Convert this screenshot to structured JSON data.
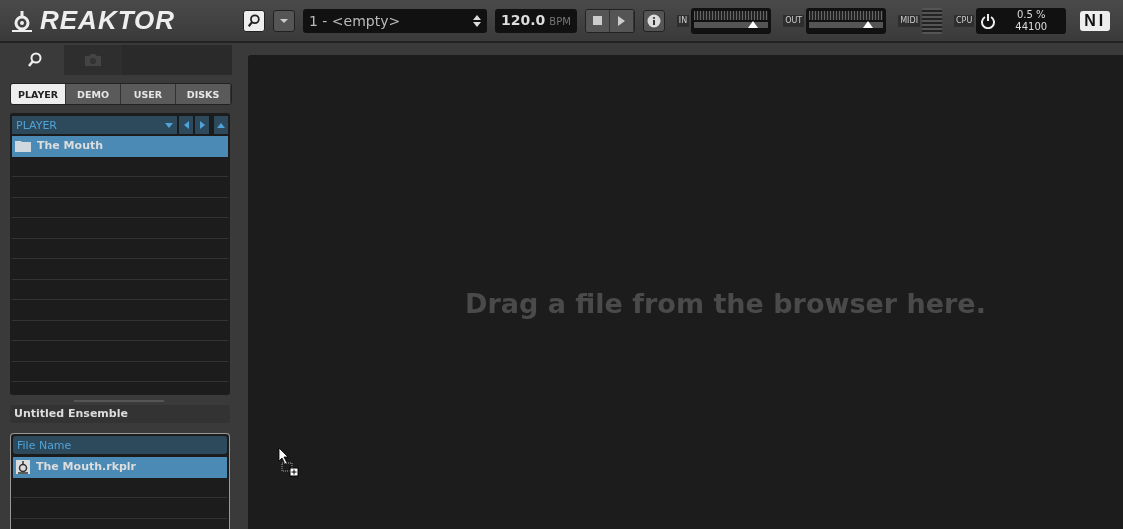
{
  "app": {
    "logo": "REAKTOR"
  },
  "toolbar": {
    "preset": "1 - <empty>",
    "tempo": "120.0",
    "tempo_unit": "BPM",
    "meters": [
      {
        "label": "IN",
        "level": 0.8
      },
      {
        "label": "OUT",
        "level": 0.8
      }
    ],
    "midi_label": "MIDI",
    "cpu_label": "CPU",
    "cpu_load": "0.5 %",
    "sample_rate": "44100",
    "vendor_logo": "NI"
  },
  "browser": {
    "tabs": [
      {
        "kind": "search",
        "selected": true
      },
      {
        "kind": "snapshot",
        "selected": false
      }
    ],
    "locations": [
      {
        "label": "PLAYER",
        "selected": true
      },
      {
        "label": "DEMO",
        "selected": false
      },
      {
        "label": "USER",
        "selected": false
      },
      {
        "label": "DISKS",
        "selected": false
      }
    ],
    "path": "PLAYER",
    "items": [
      {
        "name": "The Mouth",
        "selected": true
      }
    ]
  },
  "ensemble": {
    "name": "Untitled Ensemble",
    "column": "File Name",
    "files": [
      {
        "name": "The Mouth.rkplr",
        "selected": true
      }
    ]
  },
  "main": {
    "message": "Drag a file from the browser here."
  }
}
